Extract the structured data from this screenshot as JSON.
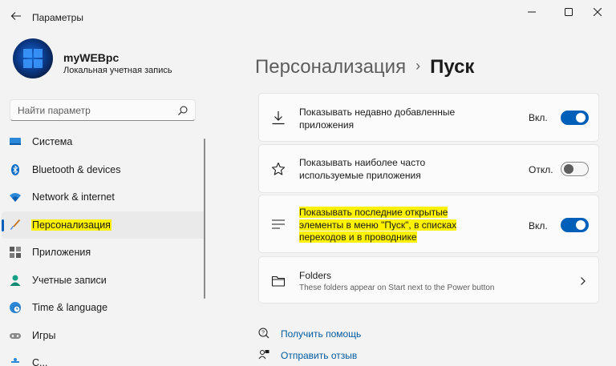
{
  "window": {
    "title": "Параметры",
    "controls": [
      "minimize-icon",
      "maximize-icon",
      "close-icon"
    ]
  },
  "profile": {
    "name": "myWEBpc",
    "account_type": "Локальная учетная запись"
  },
  "search": {
    "placeholder": "Найти параметр"
  },
  "sidebar": {
    "items": [
      {
        "label": "Система",
        "icon": "monitor-icon",
        "active": false
      },
      {
        "label": "Bluetooth & devices",
        "icon": "bluetooth-icon",
        "active": false
      },
      {
        "label": "Network & internet",
        "icon": "wifi-icon",
        "active": false
      },
      {
        "label": "Персонализация",
        "icon": "brush-icon",
        "active": true
      },
      {
        "label": "Приложения",
        "icon": "apps-icon",
        "active": false
      },
      {
        "label": "Учетные записи",
        "icon": "person-icon",
        "active": false
      },
      {
        "label": "Time & language",
        "icon": "globe-clock-icon",
        "active": false
      },
      {
        "label": "Игры",
        "icon": "gamepad-icon",
        "active": false
      },
      {
        "label": "С...",
        "icon": "accessibility-icon",
        "active": false
      }
    ]
  },
  "breadcrumb": {
    "parent": "Персонализация",
    "separator": "›",
    "current": "Пуск"
  },
  "settings": [
    {
      "icon": "download-icon",
      "line1": "Показывать недавно добавленные",
      "line2": "приложения",
      "state_label": "Вкл.",
      "on": true
    },
    {
      "icon": "star-icon",
      "line1": "Показывать наиболее часто",
      "line2": "используемые приложения",
      "state_label": "Откл.",
      "on": false
    },
    {
      "icon": "list-icon",
      "line1": "Показывать последние открытые",
      "line2": "элементы в меню \"Пуск\", в списках",
      "line3": "переходов и в проводнике",
      "state_label": "Вкл.",
      "on": true,
      "highlighted": true
    },
    {
      "icon": "folder-icon",
      "title": "Folders",
      "subtitle": "These folders appear on Start next to the Power button",
      "chevron": "chevron-right-icon"
    }
  ],
  "links": [
    {
      "label": "Получить помощь",
      "icon": "help-icon"
    },
    {
      "label": "Отправить отзыв",
      "icon": "feedback-icon"
    }
  ],
  "colors": {
    "accent": "#005fb8",
    "highlight": "#fff200",
    "background": "#f3f3f3",
    "card": "#fbfbfb"
  }
}
